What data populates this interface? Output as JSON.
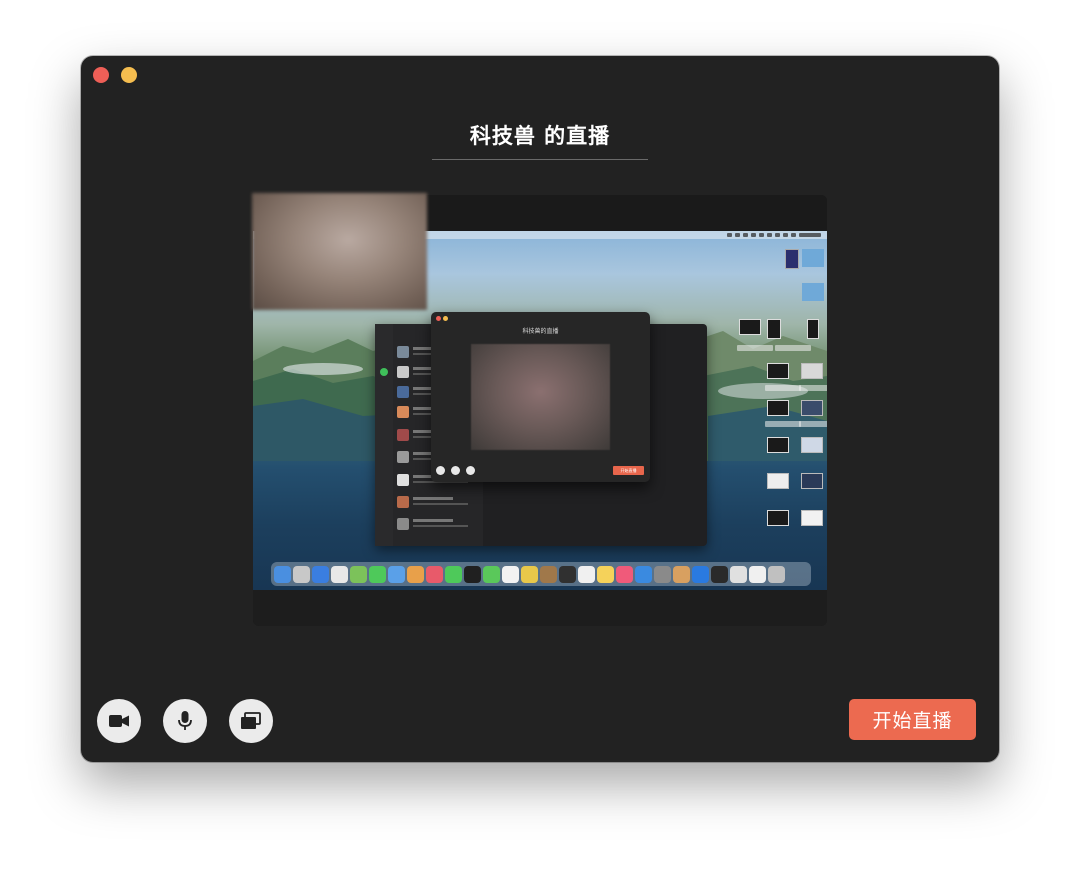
{
  "window": {
    "title": "科技兽 的直播",
    "traffic_lights": [
      "close",
      "minimize"
    ],
    "colors": {
      "background": "#222222",
      "close": "#ee5f57",
      "minimize": "#f5bd4f"
    }
  },
  "preview": {
    "nested_window_title": "科技兽的直播",
    "nested_start_label": "开始直播"
  },
  "controls": {
    "icons": [
      "camera-icon",
      "microphone-icon",
      "screen-share-icon"
    ],
    "start_label": "开始直播",
    "accent_color": "#ec6a50"
  }
}
